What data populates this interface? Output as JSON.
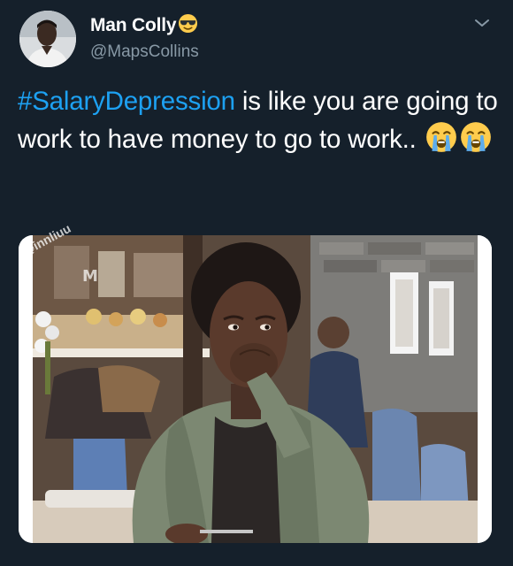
{
  "tweet": {
    "display_name": "Man Colly",
    "handle": "@MapsCollins",
    "hashtag": "#SalaryDepression",
    "text": " is like you are going to work to have money to go to work..",
    "watermark": "@innliuu"
  },
  "icons": {
    "name_emoji": "smiling-face-with-sunglasses-icon",
    "text_emojis": [
      "loudly-crying-face-icon",
      "loudly-crying-face-icon"
    ],
    "menu": "chevron-down-icon"
  },
  "colors": {
    "background": "#15202b",
    "hashtag": "#1da1f2",
    "secondary_text": "#8899a6"
  }
}
